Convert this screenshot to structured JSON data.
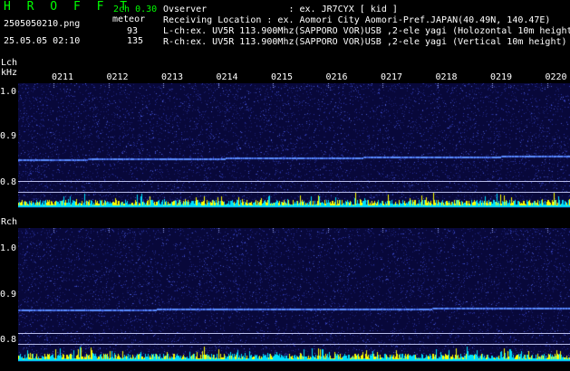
{
  "header": {
    "app_title": "H R O F F T",
    "mode": "2ch 0.30",
    "filename": "2505050210.png",
    "event_label": "meteor",
    "datetime": "25.05.05 02:10",
    "lch_count": "93",
    "rch_count": "135",
    "observer": "Ovserver               : ex. JR7CYX [ kid ]",
    "location": "Receiving Location : ex. Aomori City Aomori-Pref.JAPAN(40.49N, 140.47E)",
    "lch_info": "L-ch:ex. UV5R 113.900Mhz(SAPPORO VOR)USB ,2-ele yagi (Holozontal 10m height)",
    "rch_info": "R-ch:ex. UV5R 113.900Mhz(SAPPORO VOR)USB ,2-ele yagi (Vertical 10m height)"
  },
  "axes": {
    "lch_label": "Lch",
    "unit": "kHz",
    "rch_label": "Rch",
    "y_ticks_top": [
      "1.0",
      "0.9",
      "0.8"
    ],
    "y_ticks_bottom": [
      "1.0",
      "0.9",
      "0.8"
    ],
    "time_labels": [
      "0211",
      "0212",
      "0213",
      "0214",
      "0215",
      "0216",
      "0217",
      "0218",
      "0219",
      "0220"
    ]
  },
  "colors": {
    "background": "#000000",
    "spectrogram_bg": "#08083a",
    "signal_line": "#5a8cff",
    "activity_cyan": "#00e0ff",
    "activity_yellow": "#ffff00",
    "text_green": "#00ff00",
    "text_white": "#ffffff"
  }
}
